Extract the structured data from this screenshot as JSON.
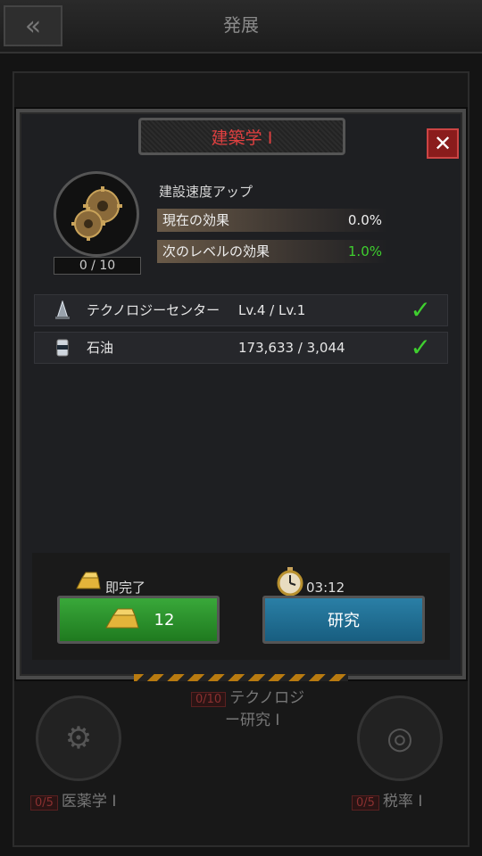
{
  "header": {
    "title": "発展",
    "back_icon": "double-chevron-left-icon"
  },
  "dialog": {
    "title": "建築学 I",
    "close_label": "✕",
    "skill": {
      "icon": "gears-icon",
      "level": "0 / 10",
      "effect_name": "建設速度アップ",
      "current_label": "現在の効果",
      "current_value": "0.0%",
      "next_label": "次のレベルの効果",
      "next_value": "1.0%"
    },
    "requirements": [
      {
        "icon": "tech-center-icon",
        "name": "テクノロジーセンター",
        "value": "Lv.4 / Lv.1",
        "status": "check-icon"
      },
      {
        "icon": "oil-barrel-icon",
        "name": "石油",
        "value": "173,633 / 3,044",
        "status": "check-icon"
      }
    ],
    "instant": {
      "label": "即完了",
      "button_value": "12",
      "icon": "gold-bar-icon"
    },
    "research": {
      "timer": "03:12",
      "button_label": "研究",
      "icon": "stopwatch-icon"
    }
  },
  "background": {
    "tree_nodes": [
      {
        "badge": "0/10",
        "label_line1": "テクノロジ",
        "label_line2": "ー研究 I"
      },
      {
        "badge": "0/5",
        "label": "医薬学 I"
      },
      {
        "badge": "0/5",
        "label": "税率 I"
      }
    ]
  },
  "colors": {
    "green_value": "#3fcf2f",
    "title_red": "#e04040",
    "button_green": "#2e9b2e",
    "button_blue": "#2173a0"
  }
}
